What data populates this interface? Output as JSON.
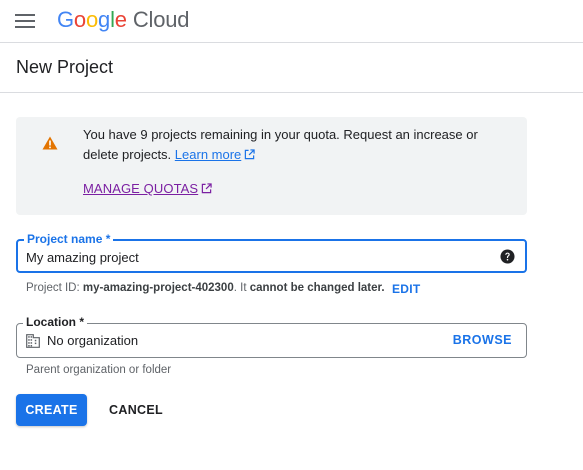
{
  "header": {
    "logo_letters": [
      "G",
      "o",
      "o",
      "g",
      "l",
      "e"
    ],
    "logo_product": "Cloud",
    "menu_icon": "hamburger-menu-icon"
  },
  "page": {
    "title": "New Project"
  },
  "warning": {
    "icon": "warning-icon",
    "message": "You have 9 projects remaining in your quota. Request an increase or delete projects.",
    "learn_more": "Learn more",
    "manage_quotas": "MANAGE QUOTAS"
  },
  "project_name": {
    "label": "Project name *",
    "value": "My amazing project",
    "help_icon": "help-circle-icon"
  },
  "project_id": {
    "prefix": "Project ID:",
    "id": "my-amazing-project-402300",
    "middle": ". It",
    "warning": "cannot be changed later.",
    "edit_label": "EDIT"
  },
  "location": {
    "label": "Location *",
    "value": "No organization",
    "browse_label": "BROWSE",
    "helper": "Parent organization or folder",
    "icon": "building-icon"
  },
  "actions": {
    "create_label": "CREATE",
    "cancel_label": "CANCEL"
  },
  "colors": {
    "primary": "#1a73e8",
    "warning": "#e37400",
    "visited_link": "#7b1fa2",
    "panel_bg": "#f1f3f4"
  }
}
